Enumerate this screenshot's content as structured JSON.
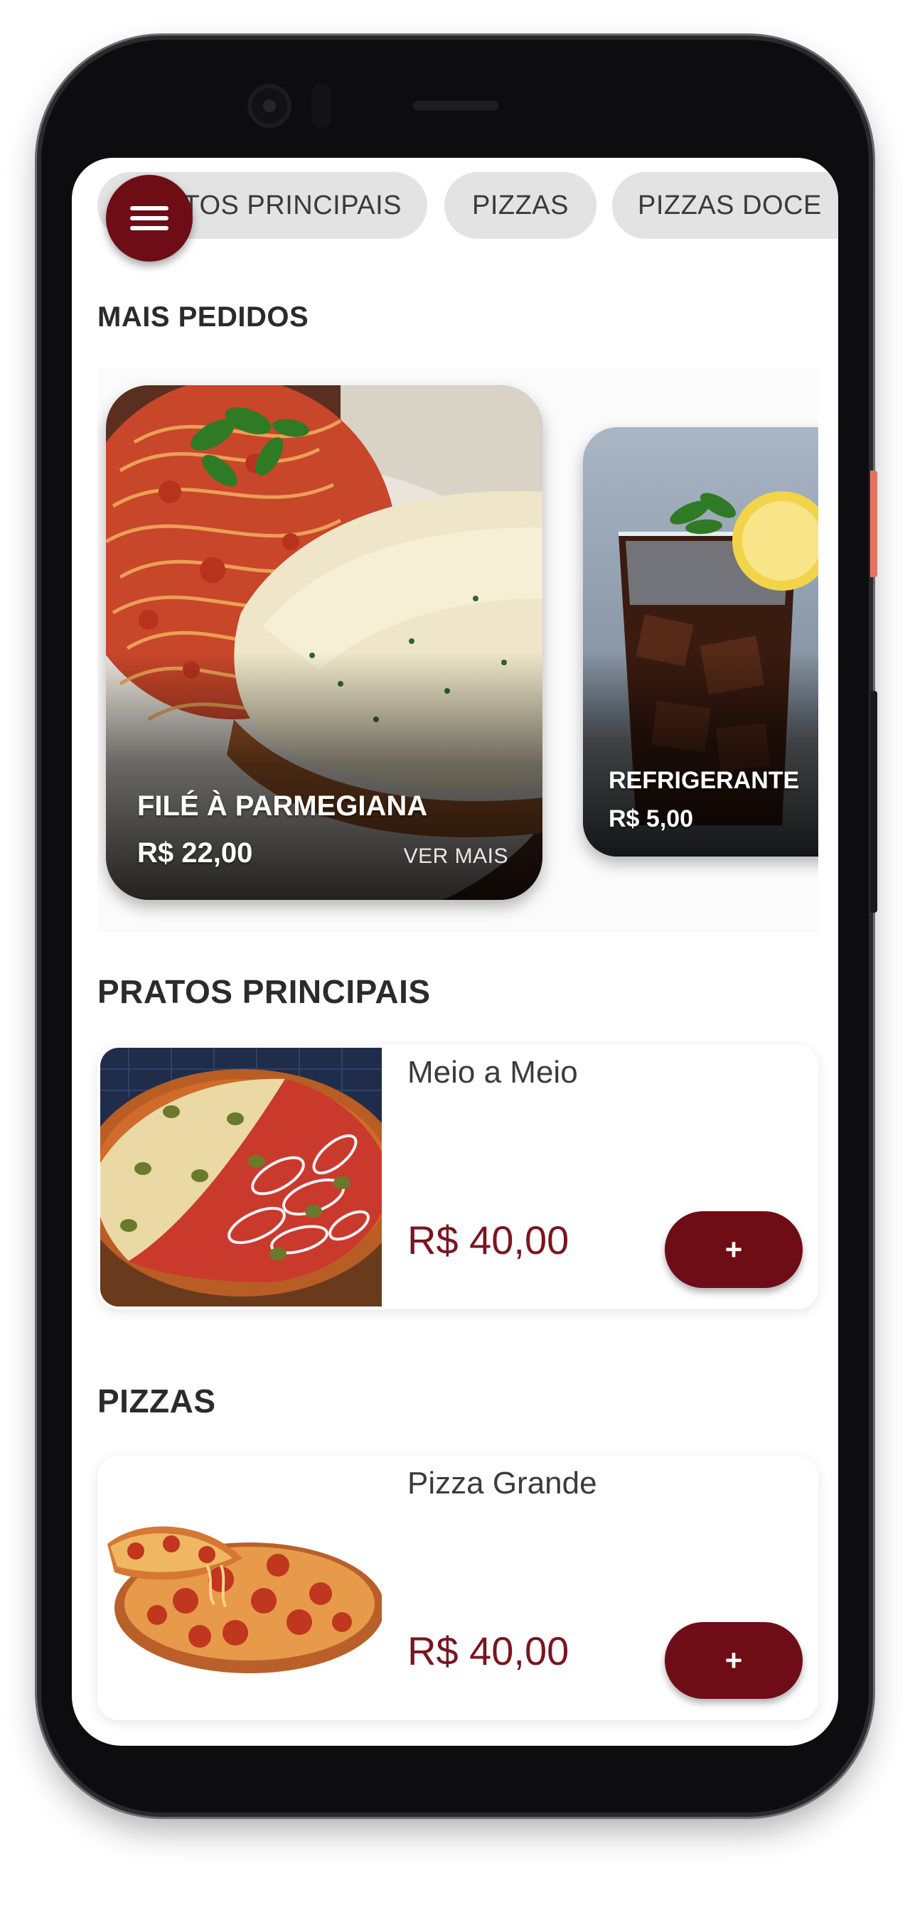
{
  "categories": [
    "PRATOS PRINCIPAIS",
    "PIZZAS",
    "PIZZAS DOCES"
  ],
  "categories_visible": [
    "TOS PRINCIPAIS",
    "PIZZAS",
    "PIZZAS DOCE"
  ],
  "menu_button": {
    "icon": "hamburger-menu-icon"
  },
  "featured": {
    "title": "MAIS PEDIDOS",
    "items": [
      {
        "name": "FILÉ À PARMEGIANA",
        "price": "R$ 22,00",
        "more_label": "VER MAIS"
      },
      {
        "name": "REFRIGERANTE",
        "price": "R$ 5,00"
      }
    ]
  },
  "sections": [
    {
      "title": "PRATOS PRINCIPAIS",
      "products": [
        {
          "name": "Meio a Meio",
          "price": "R$ 40,00",
          "add_label": "+"
        }
      ]
    },
    {
      "title": "PIZZAS",
      "products": [
        {
          "name": "Pizza Grande",
          "price": "R$ 40,00",
          "add_label": "+"
        }
      ]
    }
  ],
  "colors": {
    "accent": "#6f0d17",
    "price": "#7a1520",
    "chip_bg": "#e3e3e3",
    "text": "#2b2b2b"
  }
}
